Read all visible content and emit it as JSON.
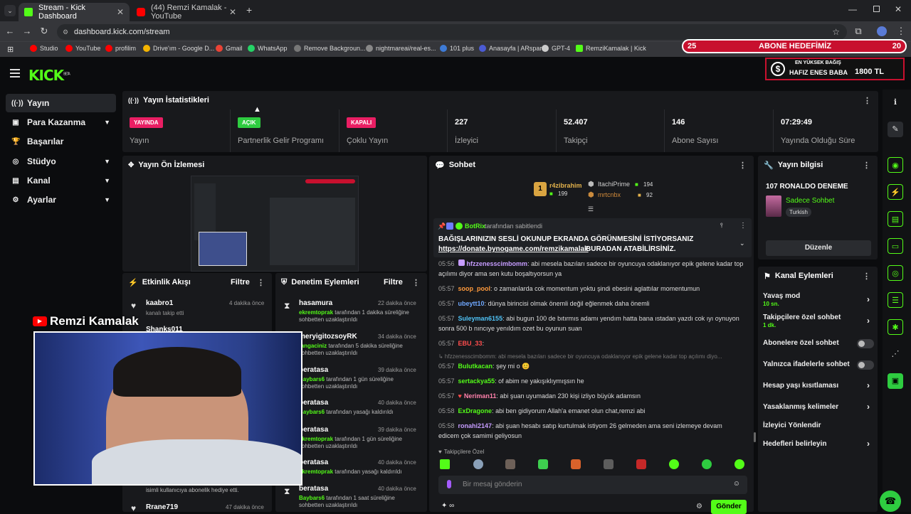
{
  "browser": {
    "tabs": [
      {
        "title": "Stream - Kick Dashboard",
        "color": "#53fc18"
      },
      {
        "title": "(44) Remzi Kamalak - YouTube",
        "color": "#ff0000"
      }
    ],
    "url": "dashboard.kick.com/stream",
    "bookmarks": [
      "Studio",
      "YouTube",
      "profilim",
      "Drive'ım - Google D...",
      "Gmail",
      "WhatsApp",
      "Remove Backgroun...",
      "nightmareai/real-es...",
      "101 plus",
      "Anasayfa | ARspar",
      "GPT-4",
      "RemziKamalak | Kick"
    ]
  },
  "overlay": {
    "goal": {
      "left": "25",
      "title": "ABONE HEDEFİMİZ",
      "right": "20"
    },
    "donor": {
      "line1": "EN YÜKSEK BAĞIŞ",
      "name": "HAFIZ ENES BABA",
      "amount": "1800 TL"
    },
    "webcam_name": "Remzi Kamalak"
  },
  "logo": "KICK",
  "logo_beta": "BETA",
  "sidebar": [
    {
      "label": "Yayın",
      "icon": "((·))"
    },
    {
      "label": "Para Kazanma",
      "icon": "▣"
    },
    {
      "label": "Başarılar",
      "icon": "🏆"
    },
    {
      "label": "Stüdyo",
      "icon": "◎"
    },
    {
      "label": "Kanal",
      "icon": "▤"
    },
    {
      "label": "Ayarlar",
      "icon": "⚙"
    }
  ],
  "stats": {
    "title": "Yayın İstatistikleri",
    "items": [
      {
        "badge": "YAYINDA",
        "label": "Yayın",
        "color": "#e91e63"
      },
      {
        "badge": "AÇIK",
        "label": "Partnerlik Gelir Programı",
        "color": "#2ecc40"
      },
      {
        "badge": "KAPALI",
        "label": "Çoklu Yayın",
        "color": "#e91e63"
      },
      {
        "value": "227",
        "label": "İzleyici"
      },
      {
        "value": "52.407",
        "label": "Takipçi"
      },
      {
        "value": "146",
        "label": "Abone Sayısı"
      },
      {
        "value": "07:29:49",
        "label": "Yayında Olduğu Süre"
      }
    ]
  },
  "preview": {
    "title": "Yayın Ön İzlemesi"
  },
  "activity": {
    "title": "Etkinlik Akışı",
    "filter": "Filtre",
    "items": [
      {
        "user": "kaabro1",
        "time": "4 dakika önce",
        "text": "kanalı takip etti"
      },
      {
        "user": "Shanks011",
        "time": "",
        "text": ""
      },
      {
        "user": "",
        "time": "",
        "text": "isimli kullanıcıya abonelik hediye etti."
      },
      {
        "user": "Rrane719",
        "time": "47 dakika önce",
        "text": ""
      }
    ]
  },
  "moderation": {
    "title": "Denetim Eylemleri",
    "filter": "Filtre",
    "items": [
      {
        "user": "hasamura",
        "time": "22 dakika önce",
        "mod": "ekremtoprak",
        "text": "tarafından 1 dakika süreliğine sohbetten uzaklaştırıldı"
      },
      {
        "user": "meryigitozsoyRK",
        "time": "34 dakika önce",
        "mod": "tangaciniz",
        "text": "tarafından 5 dakika süreliğine sohbetten uzaklaştırıldı"
      },
      {
        "user": "beratasa",
        "time": "39 dakika önce",
        "mod": "Baybars6",
        "text": "tarafından 1 gün süreliğine sohbetten uzaklaştırıldı"
      },
      {
        "user": "beratasa",
        "time": "40 dakika önce",
        "mod": "Baybars6",
        "text": "tarafından yasağı kaldırıldı"
      },
      {
        "user": "beratasa",
        "time": "39 dakika önce",
        "mod": "ekremtoprak",
        "text": "tarafından 1 gün süreliğine sohbetten uzaklaştırıldı"
      },
      {
        "user": "beratasa",
        "time": "40 dakika önce",
        "mod": "ekremtoprak",
        "text": "tarafından yasağı kaldırıldı"
      },
      {
        "user": "beratasa",
        "time": "40 dakika önce",
        "mod": "Baybars6",
        "text": "tarafından 1 saat süreliğine sohbetten uzaklaştırıldı"
      }
    ]
  },
  "chat": {
    "title": "Sohbet",
    "top": [
      {
        "user": "r4zibrahim",
        "count": "199"
      },
      {
        "user": "ItachiPrime",
        "count": "194"
      },
      {
        "user": "mrtcnbx",
        "count": "92"
      }
    ],
    "pinned": {
      "by": "BotRix",
      "by_suffix": "tarafından sabitlendi",
      "line1": "BAĞIŞLARINIZIN SESLİ OKUNUP EKRANDA GÖRÜNMESİNİ İSTİYORSANIZ",
      "link": "https://donate.bynogame.com/remzikamalak",
      "line2": "BURADAN ATABİLİRSİNİZ."
    },
    "messages": [
      {
        "time": "05:56",
        "user": "hfzzenesscimbomm",
        "color": "#c69cff",
        "text": "abi mesela bazıları sadece bir oyuncuya odaklanıyor epik gelene kadar top açılımı diyor ama sen kutu boşaltıyorsun ya"
      },
      {
        "time": "05:57",
        "user": "soop_pool",
        "color": "#ff9a3c",
        "text": "o zamanlarda cok momentum yoktu şindi ebesini aglattılar momentumun"
      },
      {
        "time": "05:57",
        "user": "ubeytt10",
        "color": "#6fa8ff",
        "text": "dünya birincisi olmak önemli değil eğlenmek daha önemli"
      },
      {
        "time": "05:57",
        "user": "Suleyman6155",
        "color": "#4fc3f7",
        "text": "abi bugun 100 de bıtırmıs adamı yendım hatta bana ıstadan yazdı cok ıyı oynuyon sonra 500 b nıncıye yenıldım ozet bu oyunun suan"
      },
      {
        "time": "05:57",
        "user": "EBU_33",
        "color": "#ff4d4d",
        "text": ""
      },
      {
        "time": "",
        "user": "",
        "color": "#777",
        "text": "↳ hfzzenesscimbomm: abi mesela bazıları sadece bir oyuncuya odaklanıyor epik gelene kadar top açılımı diyo..."
      },
      {
        "time": "05:57",
        "user": "Bulutkacan",
        "color": "#53fc18",
        "text": "şey mi o 😊"
      },
      {
        "time": "05:57",
        "user": "sertackya55",
        "color": "#53fc18",
        "text": "of abim ne yakışıklıymışsın he"
      },
      {
        "time": "05:57",
        "user": "Neriman11",
        "color": "#ff80ab",
        "text": "abi şuan uyumadan 230 kişi izliyo büyük adamsın"
      },
      {
        "time": "05:58",
        "user": "ExDragone",
        "color": "#53fc18",
        "text": "abi ben gidiyorum Allah'a emanet olun chat,remzi abi"
      },
      {
        "time": "05:58",
        "user": "ronahi2147",
        "color": "#c69cff",
        "text": "abi şuan hesabı satıp kurtulmak istiyom 26 gelmeden ama seni izlemeye devam edicem çok samimi geliyosun"
      }
    ],
    "followers_only": "Takipçilere Özel",
    "input_placeholder": "Bir mesaj gönderin",
    "send": "Gönder"
  },
  "stream_info": {
    "title": "Yayın bilgisi",
    "stream_title": "107 RONALDO DENEME",
    "category": "Sadece Sohbet",
    "tag": "Turkish",
    "edit": "Düzenle"
  },
  "channel_actions": {
    "title": "Kanal Eylemleri",
    "items": [
      {
        "label": "Yavaş mod",
        "sub": "10 sn.",
        "type": "chevron"
      },
      {
        "label": "Takipçilere özel sohbet",
        "sub": "1 dk.",
        "type": "chevron"
      },
      {
        "label": "Abonelere özel sohbet",
        "sub": "",
        "type": "toggle"
      },
      {
        "label": "Yalnızca ifadelerle sohbet",
        "sub": "",
        "type": "toggle"
      },
      {
        "label": "Hesap yaşı kısıtlaması",
        "sub": "",
        "type": "chevron"
      },
      {
        "label": "Yasaklanmış kelimeler",
        "sub": "",
        "type": "chevron"
      },
      {
        "label": "İzleyici Yönlendir",
        "sub": "",
        "type": "none"
      },
      {
        "label": "Hedefleri belirleyin",
        "sub": "",
        "type": "chevron"
      }
    ]
  }
}
